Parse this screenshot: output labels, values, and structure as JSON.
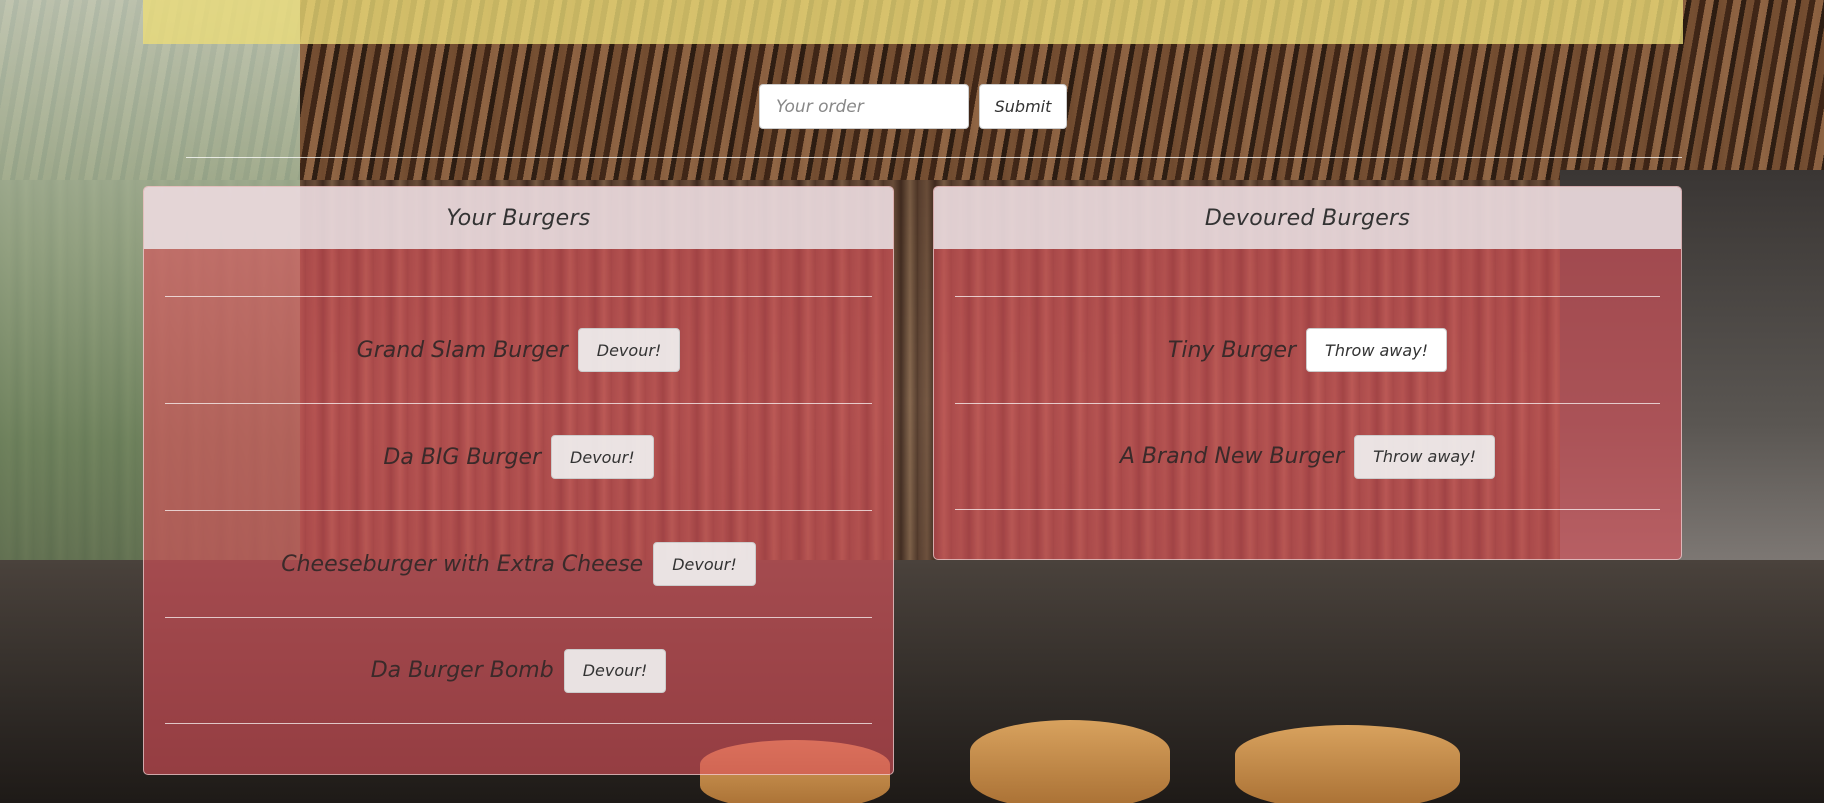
{
  "order_form": {
    "placeholder": "Your order",
    "submit_label": "Submit"
  },
  "uneaten": {
    "heading": "Your Burgers",
    "action_label": "Devour!",
    "items": [
      {
        "name": "Grand Slam Burger"
      },
      {
        "name": "Da BIG Burger"
      },
      {
        "name": "Cheeseburger with Extra Cheese"
      },
      {
        "name": "Da Burger Bomb"
      }
    ]
  },
  "devoured": {
    "heading": "Devoured Burgers",
    "action_label": "Throw away!",
    "items": [
      {
        "name": "Tiny Burger"
      },
      {
        "name": "A Brand New Burger"
      }
    ]
  },
  "colors": {
    "panel_overlay": "#dc505a",
    "jumbotron": "#ecdc78",
    "heading_bg": "#ebebee"
  }
}
